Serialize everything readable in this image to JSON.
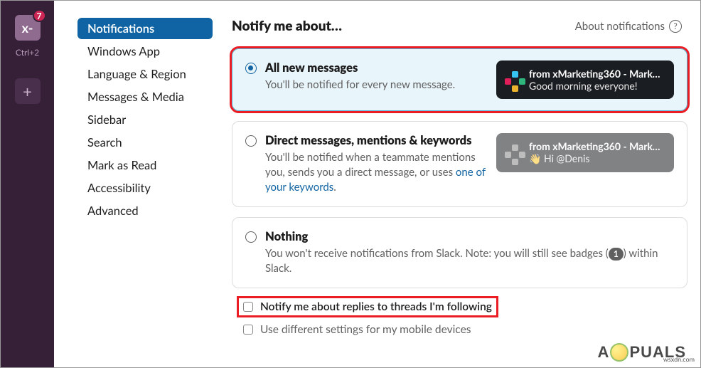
{
  "leftrail": {
    "workspace_label": "x-",
    "badge_count": "7",
    "shortcut": "Ctrl+2",
    "add_glyph": "+"
  },
  "sidebar": {
    "items": [
      {
        "label": "Notifications",
        "active": true
      },
      {
        "label": "Windows App"
      },
      {
        "label": "Language & Region"
      },
      {
        "label": "Messages & Media"
      },
      {
        "label": "Sidebar"
      },
      {
        "label": "Search"
      },
      {
        "label": "Mark as Read"
      },
      {
        "label": "Accessibility"
      },
      {
        "label": "Advanced"
      }
    ]
  },
  "header": {
    "title": "Notify me about…",
    "about_link": "About notifications"
  },
  "options": {
    "all": {
      "title": "All new messages",
      "desc": "You'll be notified for every new message.",
      "preview_from": "from xMarketing360 - Marke…",
      "preview_body": "Good morning everyone!"
    },
    "dm": {
      "title": "Direct messages, mentions & keywords",
      "desc_a": "You'll be notified when a teammate mentions you, sends you a direct message, or uses ",
      "link": "one of your keywords",
      "desc_b": ".",
      "preview_from": "from xMarketing360 - Marke…",
      "preview_body": "👋 Hi @Denis"
    },
    "none": {
      "title": "Nothing",
      "desc_a": "You won't receive notifications from Slack. Note: you will still see badges (",
      "badge": "1",
      "desc_b": ") within Slack."
    }
  },
  "checkboxes": {
    "threads": "Notify me about replies to threads I'm following",
    "mobile": "Use different settings for my mobile devices"
  },
  "watermark": {
    "prefix": "A",
    "suffix": "PUALS"
  },
  "domain": "wsxdn.com"
}
